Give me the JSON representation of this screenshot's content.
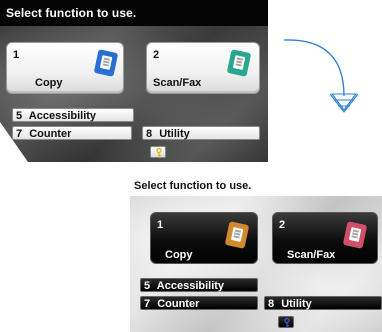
{
  "before": {
    "title": "Select function to use.",
    "tiles": [
      {
        "number": "1",
        "label": "Copy"
      },
      {
        "number": "2",
        "label": "Scan/Fax"
      }
    ],
    "buttons": [
      {
        "number": "5",
        "label": "Accessibility"
      },
      {
        "number": "7",
        "label": "Counter"
      },
      {
        "number": "8",
        "label": "Utility"
      }
    ],
    "key_icon": "key-icon"
  },
  "after": {
    "title": "Select function to use.",
    "tiles": [
      {
        "number": "1",
        "label": "Copy"
      },
      {
        "number": "2",
        "label": "Scan/Fax"
      }
    ],
    "buttons": [
      {
        "number": "5",
        "label": "Accessibility"
      },
      {
        "number": "7",
        "label": "Counter"
      },
      {
        "number": "8",
        "label": "Utility"
      }
    ],
    "key_icon": "key-icon"
  },
  "arrow": {
    "icon": "curved-down-arrow-icon",
    "color": "#2a7fd0"
  },
  "colors": {
    "copy_icon_before": "#2a6fd6",
    "scanfax_icon_before": "#2aa78f",
    "copy_icon_after": "#d28a2e",
    "scanfax_icon_after": "#d0506a",
    "key_accent_before": "#e0b400",
    "key_accent_after": "#2a5fd0"
  }
}
